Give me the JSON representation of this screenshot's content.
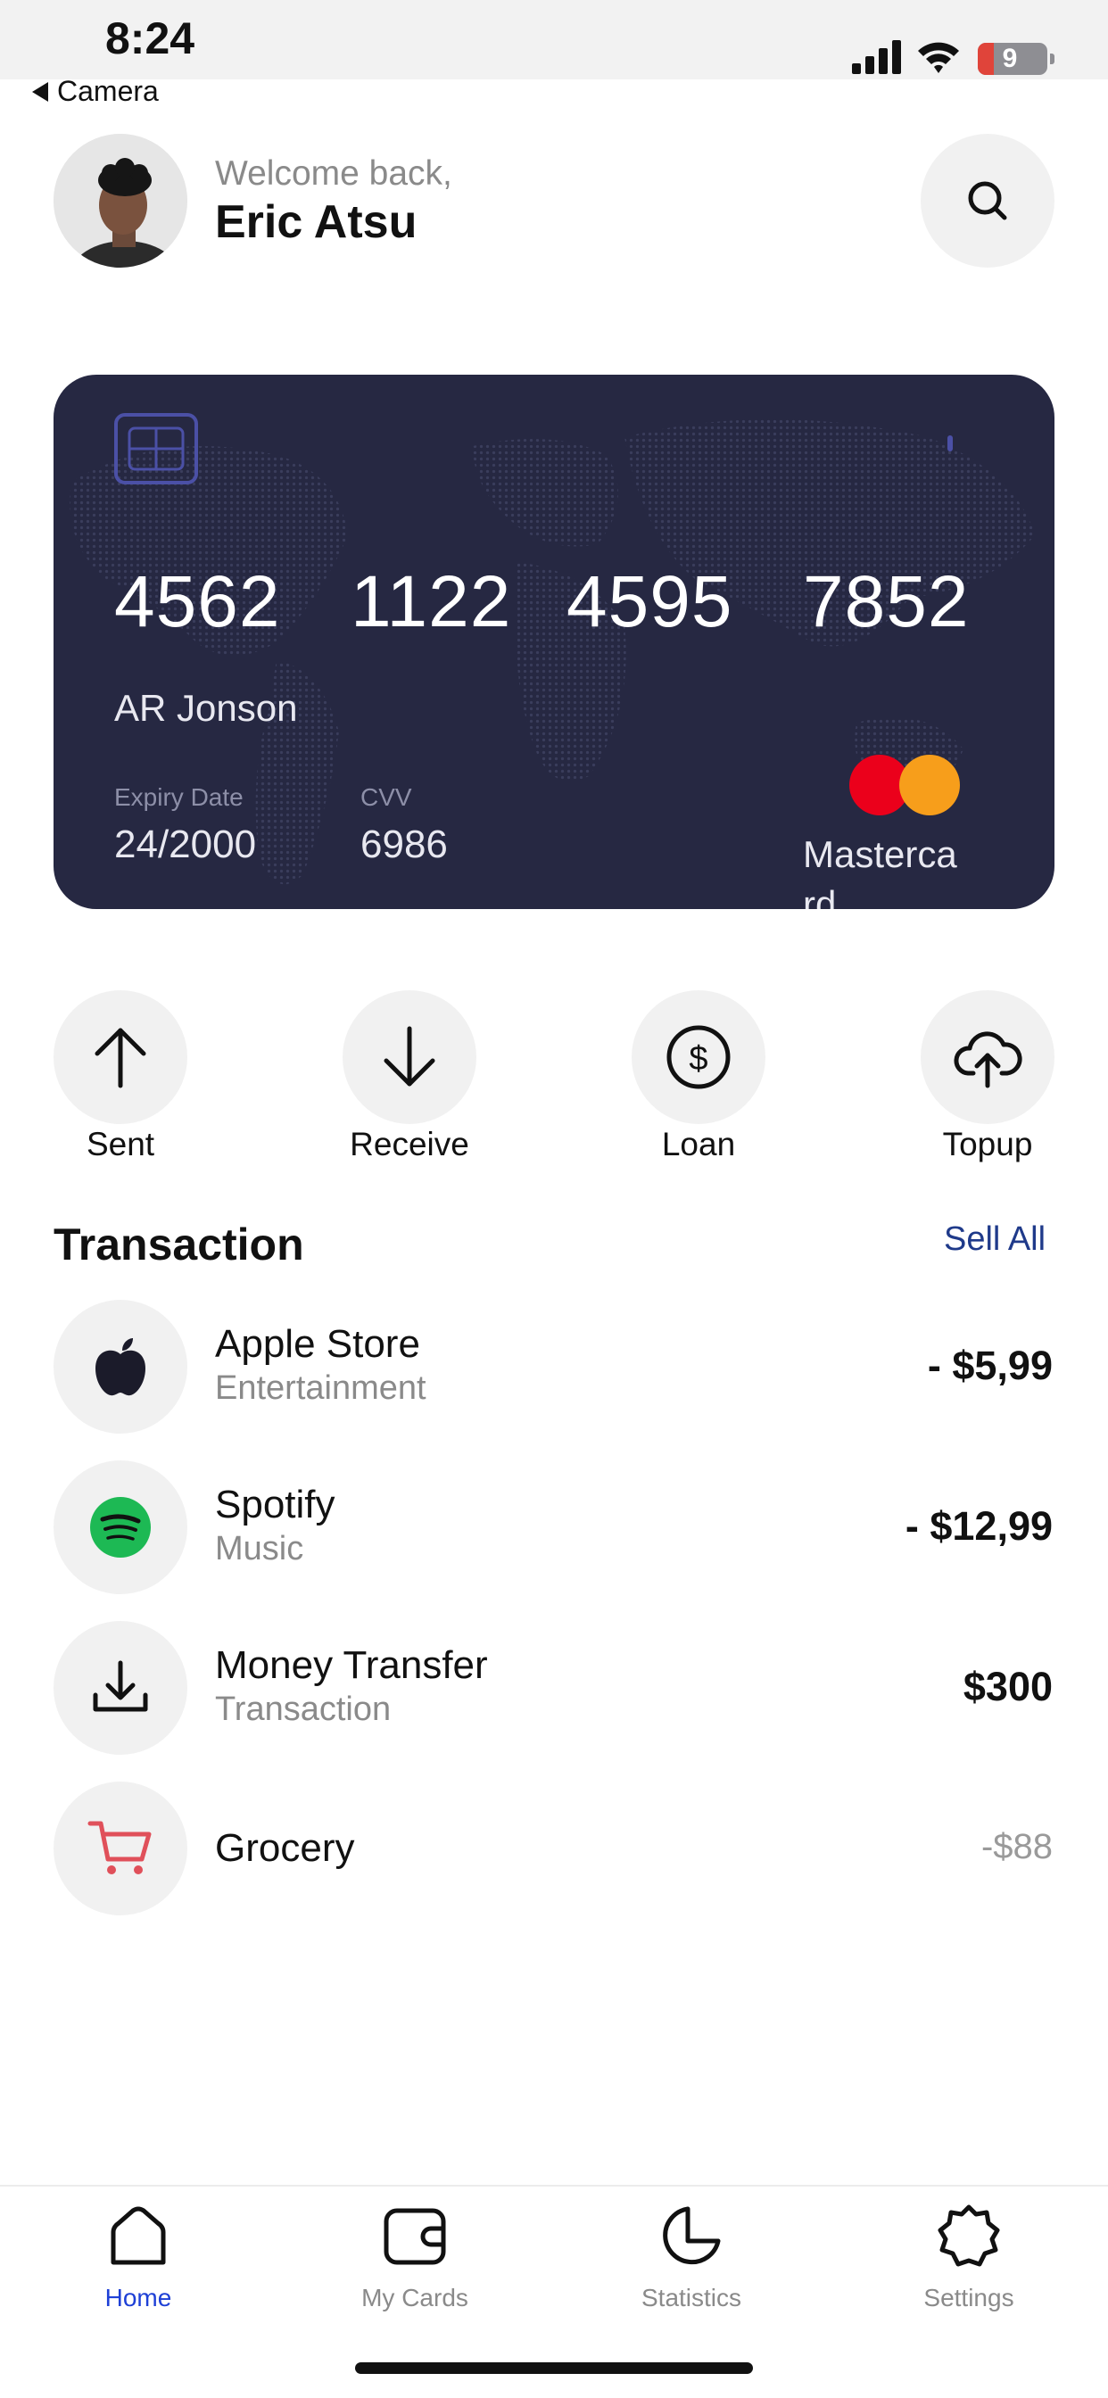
{
  "status_bar": {
    "time": "8:24",
    "back_label": "Camera",
    "battery_level": "9"
  },
  "header": {
    "welcome": "Welcome back,",
    "user_name": "Eric Atsu"
  },
  "card": {
    "number_groups": [
      "4562",
      "1122",
      "4595",
      "7852"
    ],
    "holder": "AR Jonson",
    "expiry_label": "Expiry Date",
    "expiry_value": "24/2000",
    "cvv_label": "CVV",
    "cvv_value": "6986",
    "brand": "Mastercard",
    "background_color": "#262842"
  },
  "actions": [
    {
      "label": "Sent",
      "icon": "arrow-up-icon"
    },
    {
      "label": "Receive",
      "icon": "arrow-down-icon"
    },
    {
      "label": "Loan",
      "icon": "dollar-coin-icon"
    },
    {
      "label": "Topup",
      "icon": "cloud-upload-icon"
    }
  ],
  "transactions": {
    "title": "Transaction",
    "see_all": "Sell All",
    "items": [
      {
        "name": "Apple Store",
        "category": "Entertainment",
        "amount": "- $5,99",
        "icon": "apple-icon"
      },
      {
        "name": "Spotify",
        "category": "Music",
        "amount": "- $12,99",
        "icon": "spotify-icon"
      },
      {
        "name": "Money Transfer",
        "category": "Transaction",
        "amount": "$300",
        "icon": "download-icon"
      },
      {
        "name": "Grocery",
        "category": "",
        "amount": "-$88",
        "icon": "cart-icon"
      }
    ]
  },
  "bottom_nav": {
    "items": [
      {
        "label": "Home",
        "icon": "home-icon",
        "active": true
      },
      {
        "label": "My Cards",
        "icon": "wallet-icon",
        "active": false
      },
      {
        "label": "Statistics",
        "icon": "pie-chart-icon",
        "active": false
      },
      {
        "label": "Settings",
        "icon": "settings-icon",
        "active": false
      }
    ]
  },
  "colors": {
    "accent": "#1e40d6",
    "link": "#1f3a8a",
    "mastercard_red": "#eb001b",
    "mastercard_yellow": "#f79e1b"
  }
}
